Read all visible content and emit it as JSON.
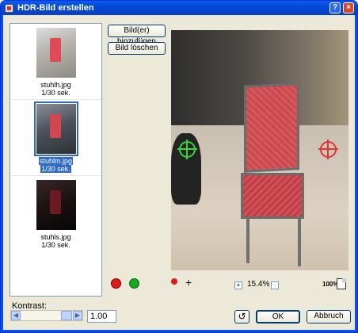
{
  "window": {
    "title": "HDR-Bild erstellen",
    "help_label": "?",
    "close_label": "×"
  },
  "thumbnails": [
    {
      "filename": "stuhlh.jpg",
      "exposure": "1/30 sek.",
      "selected": false
    },
    {
      "filename": "stuhlm.jpg",
      "exposure": "1/30 sek.",
      "selected": true
    },
    {
      "filename": "stuhls.jpg",
      "exposure": "1/30 sek.",
      "selected": false
    }
  ],
  "buttons": {
    "add_images": "Bild(er) hinzufügen",
    "delete_image": "Bild löschen",
    "ok": "OK",
    "cancel": "Abbruch"
  },
  "preview": {
    "zoom_level": "15.4%",
    "zoom_plus": "+",
    "zoom_minus": "-",
    "fit_label": "100%"
  },
  "tools": {
    "marker_add_red": "red-marker-icon",
    "marker_add_green": "green-marker-icon",
    "move_tool": "move-points-icon"
  },
  "kontrast": {
    "label": "Kontrast:",
    "value": "1.00",
    "slider_level": 0.7
  },
  "colors": {
    "title_blue": "#0a5cf0",
    "selection": "#316ac5",
    "marker_green": "#37d43b",
    "marker_red": "#e23232"
  }
}
